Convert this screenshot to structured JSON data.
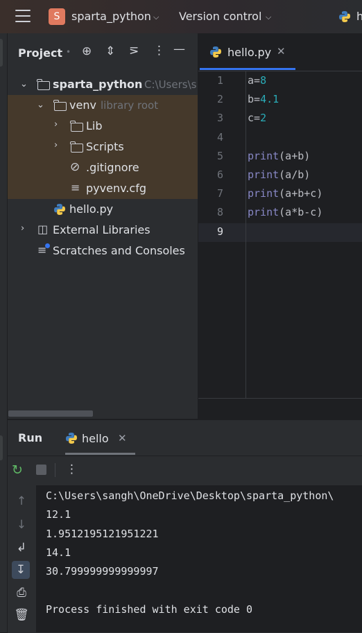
{
  "titlebar": {
    "project_badge": "S",
    "project_name": "sparta_python",
    "vcs_label": "Version control",
    "right_tab_letter": "h"
  },
  "project_panel": {
    "title": "Project",
    "tree": [
      {
        "label": "sparta_python",
        "hint": "C:\\Users\\s",
        "kind": "folder",
        "expanded": true
      },
      {
        "label": "venv",
        "hint": "library root",
        "kind": "folder",
        "expanded": true
      },
      {
        "label": "Lib",
        "kind": "folder",
        "expanded": false
      },
      {
        "label": "Scripts",
        "kind": "folder",
        "expanded": false
      },
      {
        "label": ".gitignore",
        "kind": "ignore-file"
      },
      {
        "label": "pyvenv.cfg",
        "kind": "text-file"
      },
      {
        "label": "hello.py",
        "kind": "python-file"
      },
      {
        "label": "External Libraries",
        "kind": "libraries",
        "expanded": false
      },
      {
        "label": "Scratches and Consoles",
        "kind": "scratches"
      }
    ]
  },
  "editor": {
    "tab_label": "hello.py",
    "line_numbers": [
      "1",
      "2",
      "3",
      "4",
      "5",
      "6",
      "7",
      "8",
      "9"
    ],
    "lines": [
      {
        "a": "a=",
        "b": "8",
        "c": ""
      },
      {
        "a": "b=",
        "b": "4.1",
        "c": ""
      },
      {
        "a": "c=",
        "b": "2",
        "c": ""
      },
      {
        "a": "",
        "b": "",
        "c": ""
      },
      {
        "a": "print",
        "b": "(a+b)",
        "c": ""
      },
      {
        "a": "print",
        "b": "(a/b)",
        "c": ""
      },
      {
        "a": "print",
        "b": "(a+b+c)",
        "c": ""
      },
      {
        "a": "print",
        "b": "(a*b-c)",
        "c": ""
      },
      {
        "a": "",
        "b": "",
        "c": ""
      }
    ]
  },
  "run_panel": {
    "title": "Run",
    "tab_label": "hello",
    "output": [
      "C:\\Users\\sangh\\OneDrive\\Desktop\\sparta_python\\",
      "12.1",
      "1.9512195121951221",
      "14.1",
      "30.799999999999997",
      "",
      "Process finished with exit code 0"
    ]
  },
  "colors": {
    "accent": "#3574f0",
    "badge": "#e07a5f",
    "keyword": "#8888c6",
    "number": "#2aacb8",
    "venv_highlight": "#45392b"
  }
}
